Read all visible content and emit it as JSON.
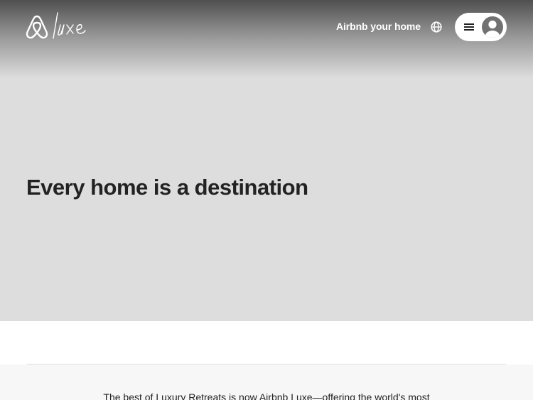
{
  "header": {
    "logo_icon": "airbnb-luxe-logo",
    "logo_text": "luxe",
    "host_link_label": "Airbnb your home",
    "globe_icon": "globe-icon",
    "menu_icon": "hamburger-menu-icon",
    "avatar_icon": "user-avatar-icon"
  },
  "hero": {
    "title": "Every home is a destination"
  },
  "intro": {
    "text": "The best of Luxury Retreats is now Airbnb Luxe—offering the world's most"
  },
  "colors": {
    "hero_background": "#dddddd",
    "text": "#222222",
    "header_text": "#ffffff",
    "band_background": "#f7f7f7"
  }
}
